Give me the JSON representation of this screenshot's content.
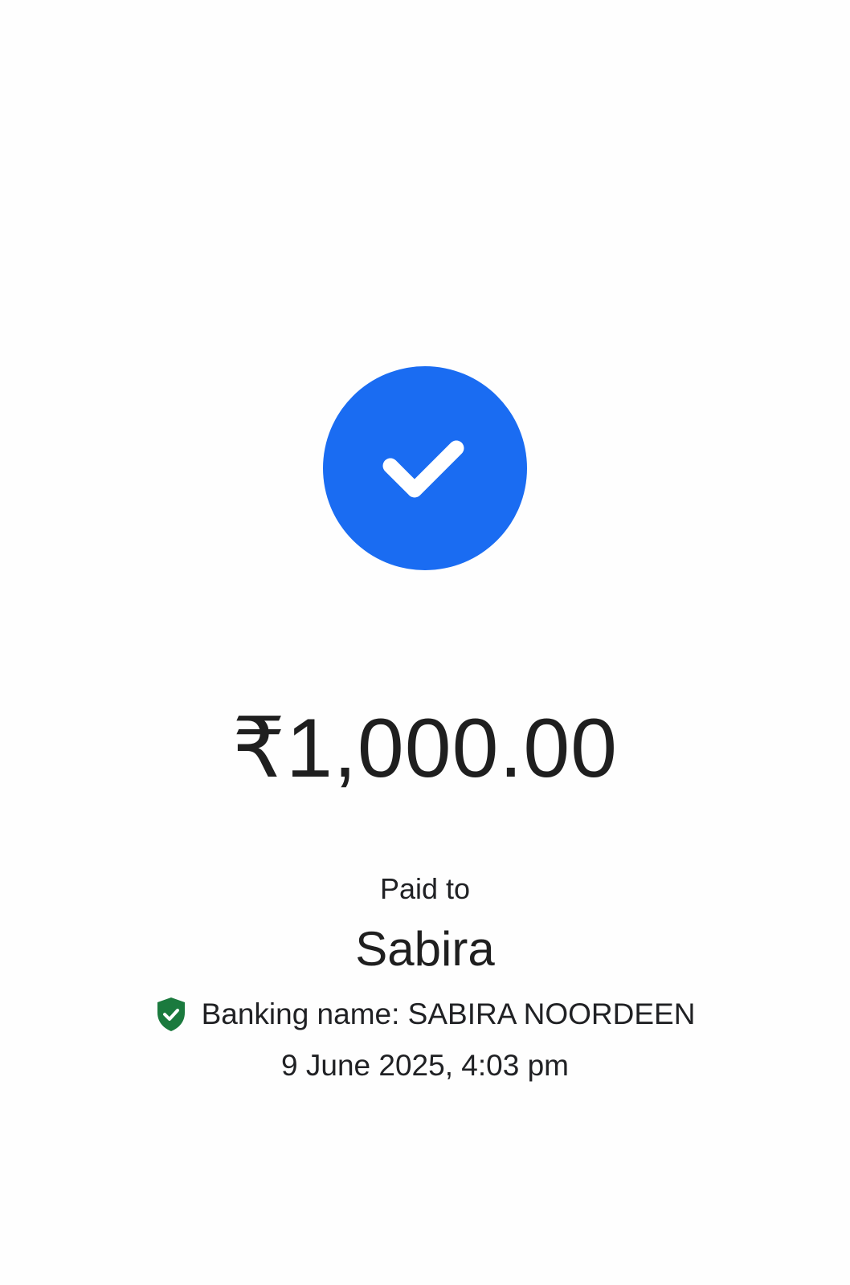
{
  "colors": {
    "background": "#fefefe",
    "success_blue": "#1a6cf2",
    "verified_green": "#1b7a3e",
    "text_primary": "#202124"
  },
  "icons": {
    "success": "checkmark-circle-icon",
    "verified": "verified-shield-icon"
  },
  "payment": {
    "amount": "₹1,000.00",
    "paid_to_label": "Paid to",
    "payee_name": "Sabira",
    "banking_name": "Banking name: SABIRA NOORDEEN",
    "timestamp": "9 June 2025, 4:03 pm"
  }
}
